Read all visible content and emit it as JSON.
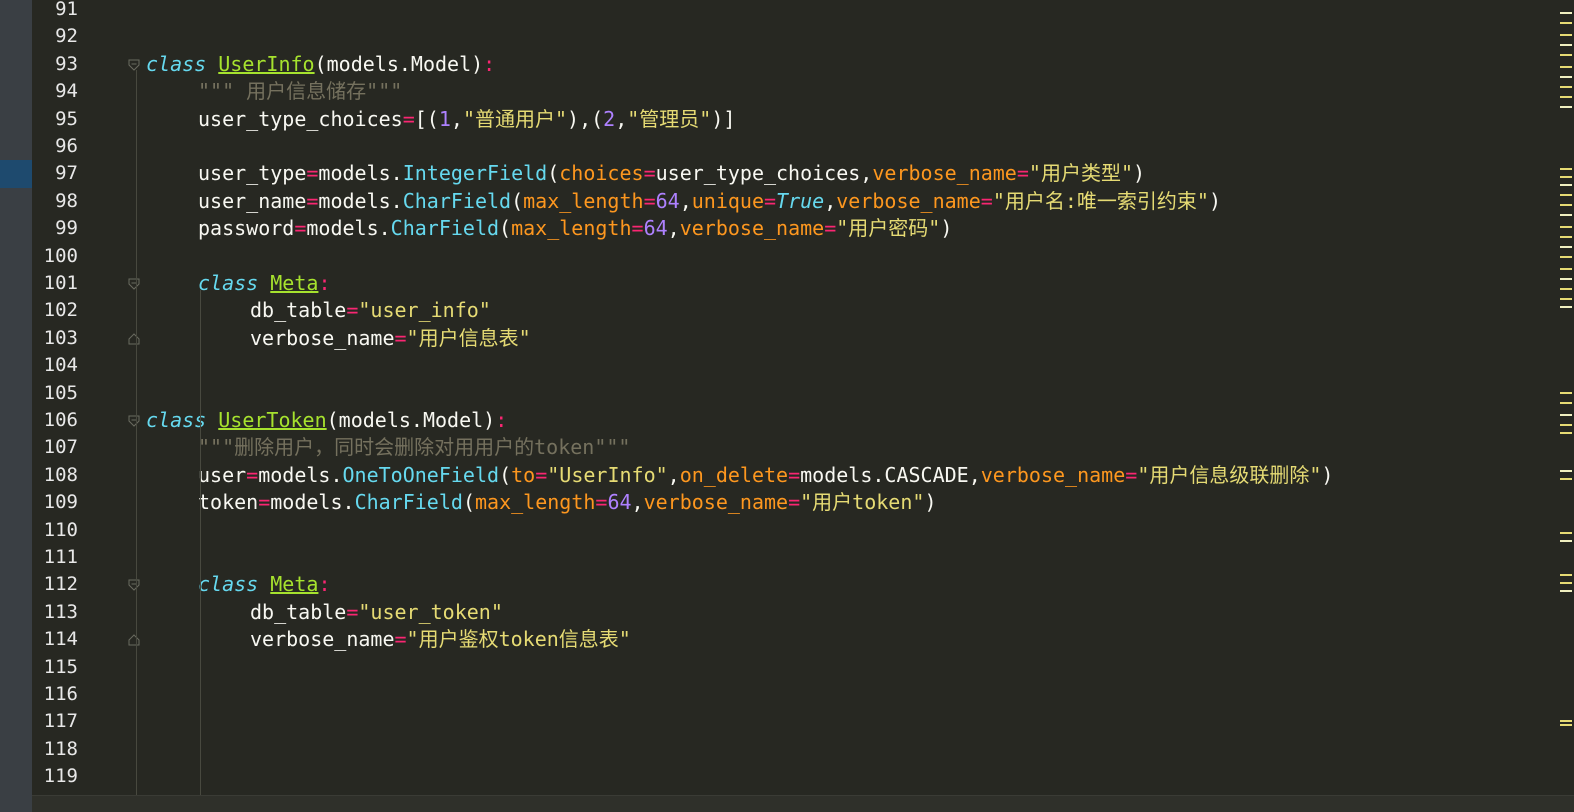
{
  "lines": [
    {
      "n": "91",
      "tokens": []
    },
    {
      "n": "92",
      "tokens": []
    },
    {
      "n": "93",
      "tokens": [
        [
          "kw",
          "class"
        ],
        [
          "",
          ""
        ],
        [
          "cls",
          "UserInfo"
        ],
        [
          "",
          "(models.Model)"
        ],
        [
          "op",
          ":"
        ]
      ]
    },
    {
      "n": "94",
      "tokens": [
        [
          "cm",
          "\"\"\" 用户信息储存\"\"\""
        ]
      ]
    },
    {
      "n": "95",
      "tokens": [
        [
          "",
          "user_type_choices"
        ],
        [
          "op",
          "="
        ],
        [
          "",
          "[("
        ],
        [
          "num",
          "1"
        ],
        [
          "",
          ","
        ],
        [
          "str",
          "\"普通用户\""
        ],
        [
          "",
          "),("
        ],
        [
          "num",
          "2"
        ],
        [
          "",
          ","
        ],
        [
          "str",
          "\"管理员\""
        ],
        [
          "",
          ")]"
        ]
      ]
    },
    {
      "n": "96",
      "tokens": []
    },
    {
      "n": "97",
      "tokens": [
        [
          "",
          "user_type"
        ],
        [
          "op",
          "="
        ],
        [
          "",
          "models."
        ],
        [
          "fn",
          "IntegerField"
        ],
        [
          "",
          "("
        ],
        [
          "kwarg",
          "choices"
        ],
        [
          "op",
          "="
        ],
        [
          "",
          "user_type_choices,"
        ],
        [
          "kwarg",
          "verbose_name"
        ],
        [
          "op",
          "="
        ],
        [
          "str",
          "\"用户类型\""
        ],
        [
          "",
          ")"
        ]
      ]
    },
    {
      "n": "98",
      "tokens": [
        [
          "",
          "user_name"
        ],
        [
          "op",
          "="
        ],
        [
          "",
          "models."
        ],
        [
          "fn",
          "CharField"
        ],
        [
          "",
          "("
        ],
        [
          "kwarg",
          "max_length"
        ],
        [
          "op",
          "="
        ],
        [
          "num",
          "64"
        ],
        [
          "",
          ","
        ],
        [
          "kwarg",
          "unique"
        ],
        [
          "op",
          "="
        ],
        [
          "bool",
          "True"
        ],
        [
          "",
          ","
        ],
        [
          "kwarg",
          "verbose_name"
        ],
        [
          "op",
          "="
        ],
        [
          "str",
          "\"用户名:唯一索引约束\""
        ],
        [
          "",
          ")"
        ]
      ]
    },
    {
      "n": "99",
      "tokens": [
        [
          "",
          "password"
        ],
        [
          "op",
          "="
        ],
        [
          "",
          "models."
        ],
        [
          "fn",
          "CharField"
        ],
        [
          "",
          "("
        ],
        [
          "kwarg",
          "max_length"
        ],
        [
          "op",
          "="
        ],
        [
          "num",
          "64"
        ],
        [
          "",
          ","
        ],
        [
          "kwarg",
          "verbose_name"
        ],
        [
          "op",
          "="
        ],
        [
          "str",
          "\"用户密码\""
        ],
        [
          "",
          ")"
        ]
      ]
    },
    {
      "n": "100",
      "tokens": []
    },
    {
      "n": "101",
      "tokens": [
        [
          "kw",
          "class"
        ],
        [
          "",
          ""
        ],
        [
          "cls",
          "Meta"
        ],
        [
          "op",
          ":"
        ]
      ]
    },
    {
      "n": "102",
      "tokens": [
        [
          "",
          "db_table"
        ],
        [
          "op",
          "="
        ],
        [
          "str",
          "\"user_info\""
        ]
      ]
    },
    {
      "n": "103",
      "tokens": [
        [
          "",
          "verbose_name"
        ],
        [
          "op",
          "="
        ],
        [
          "str",
          "\"用户信息表\""
        ]
      ]
    },
    {
      "n": "104",
      "tokens": []
    },
    {
      "n": "105",
      "tokens": []
    },
    {
      "n": "106",
      "tokens": [
        [
          "kw",
          "class"
        ],
        [
          "",
          ""
        ],
        [
          "cls",
          "UserToken"
        ],
        [
          "",
          "(models.Model)"
        ],
        [
          "op",
          ":"
        ]
      ]
    },
    {
      "n": "107",
      "tokens": [
        [
          "cm",
          "\"\"\"删除用户，同时会删除对用用户的token\"\"\""
        ]
      ]
    },
    {
      "n": "108",
      "tokens": [
        [
          "",
          "user"
        ],
        [
          "op",
          "="
        ],
        [
          "",
          "models."
        ],
        [
          "fn",
          "OneToOneField"
        ],
        [
          "",
          "("
        ],
        [
          "kwarg",
          "to"
        ],
        [
          "op",
          "="
        ],
        [
          "str",
          "\"UserInfo\""
        ],
        [
          "",
          ","
        ],
        [
          "kwarg",
          "on_delete"
        ],
        [
          "op",
          "="
        ],
        [
          "",
          "models.CASCADE,"
        ],
        [
          "kwarg",
          "verbose_name"
        ],
        [
          "op",
          "="
        ],
        [
          "str",
          "\"用户信息级联删除\""
        ],
        [
          "",
          ")"
        ]
      ]
    },
    {
      "n": "109",
      "tokens": [
        [
          "",
          "token"
        ],
        [
          "op",
          "="
        ],
        [
          "",
          "models."
        ],
        [
          "fn",
          "CharField"
        ],
        [
          "",
          "("
        ],
        [
          "kwarg",
          "max_length"
        ],
        [
          "op",
          "="
        ],
        [
          "num",
          "64"
        ],
        [
          "",
          ","
        ],
        [
          "kwarg",
          "verbose_name"
        ],
        [
          "op",
          "="
        ],
        [
          "str",
          "\"用户token\""
        ],
        [
          "",
          ")"
        ]
      ]
    },
    {
      "n": "110",
      "tokens": []
    },
    {
      "n": "111",
      "tokens": []
    },
    {
      "n": "112",
      "tokens": [
        [
          "kw",
          "class"
        ],
        [
          "",
          ""
        ],
        [
          "cls",
          "Meta"
        ],
        [
          "op",
          ":"
        ]
      ]
    },
    {
      "n": "113",
      "tokens": [
        [
          "",
          "db_table"
        ],
        [
          "op",
          "="
        ],
        [
          "str",
          "\"user_token\""
        ]
      ]
    },
    {
      "n": "114",
      "tokens": [
        [
          "",
          "verbose_name"
        ],
        [
          "op",
          "="
        ],
        [
          "str",
          "\"用户鉴权token信息表\""
        ]
      ]
    },
    {
      "n": "115",
      "tokens": []
    },
    {
      "n": "116",
      "tokens": []
    },
    {
      "n": "117",
      "tokens": []
    },
    {
      "n": "118",
      "tokens": []
    },
    {
      "n": "119",
      "tokens": []
    }
  ],
  "colors": {
    "background": "#272822",
    "keyword": "#66d9ef",
    "class_name": "#a6e22e",
    "operator": "#f92672",
    "string": "#e6db74",
    "number": "#ae81ff",
    "kwarg": "#fd971f",
    "comment": "#75715e"
  }
}
